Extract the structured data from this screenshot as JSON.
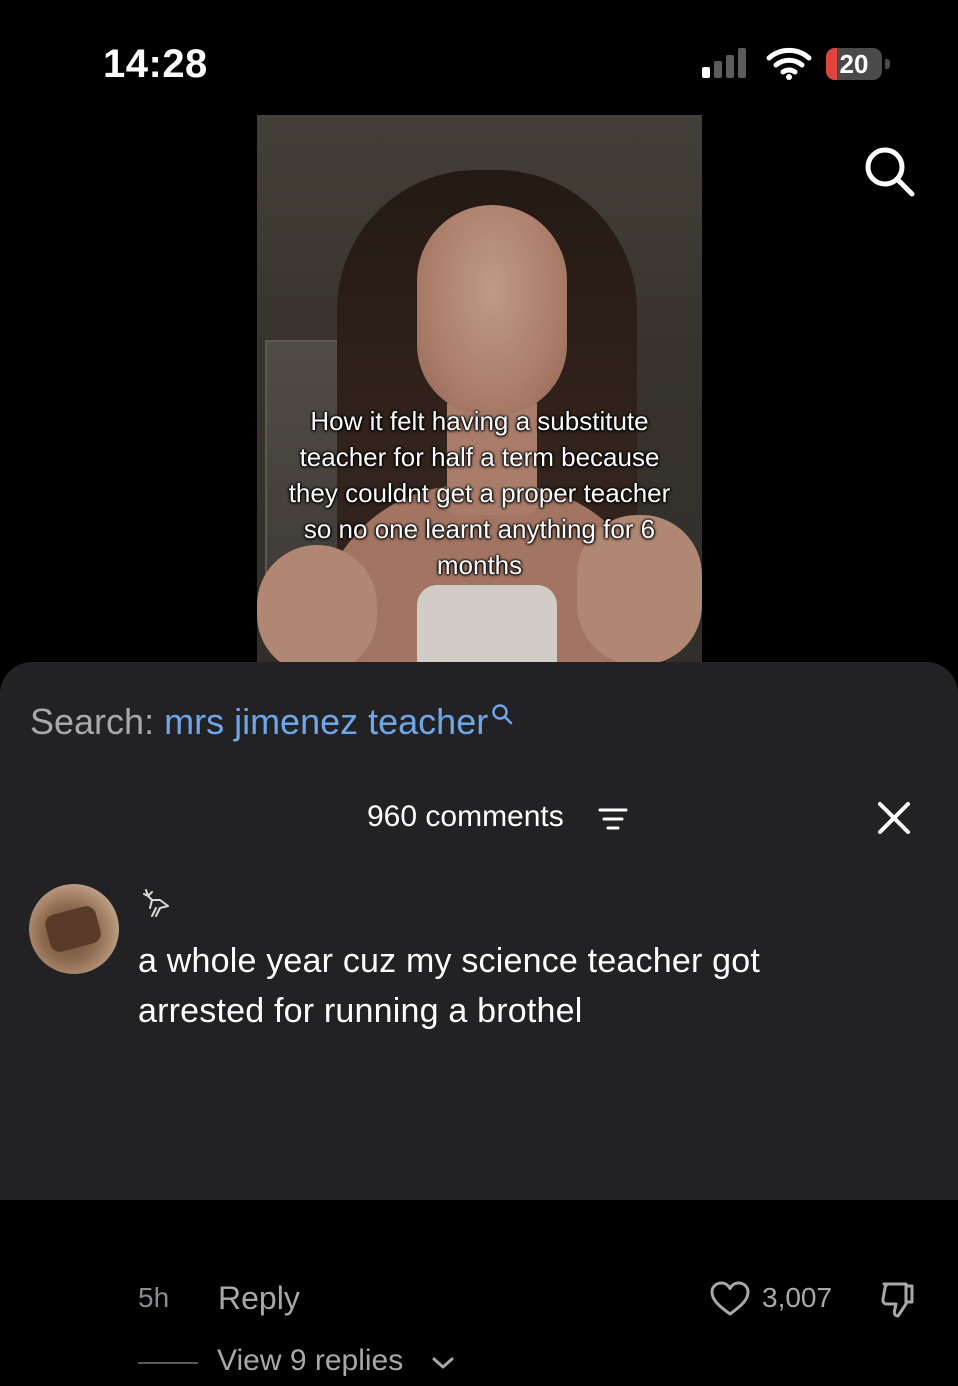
{
  "status_bar": {
    "time": "14:28",
    "battery_level": "20",
    "battery_fill_fraction": 0.2,
    "battery_color": "#e0443e"
  },
  "video": {
    "caption": "How it felt having a substitute teacher for half a term because they couldnt get a proper teacher so no one learnt anything for 6 months"
  },
  "search_suggestion": {
    "prefix": "Search:",
    "query": "mrs jimenez teacher",
    "query_color": "#6fa6ea"
  },
  "comments": {
    "count_label": "960 comments",
    "items": [
      {
        "text": "a whole year cuz my science teacher got arrested for running a brothel",
        "time": "5h",
        "reply_label": "Reply",
        "likes": "3,007",
        "view_replies_label": "View 9 replies"
      }
    ]
  },
  "icons": {
    "search": "search-icon",
    "close": "close-icon",
    "sort": "sort-icon",
    "like": "heart-icon",
    "dislike": "thumbs-down-icon",
    "user_badge": "deer-icon",
    "chevron": "chevron-down-icon"
  }
}
